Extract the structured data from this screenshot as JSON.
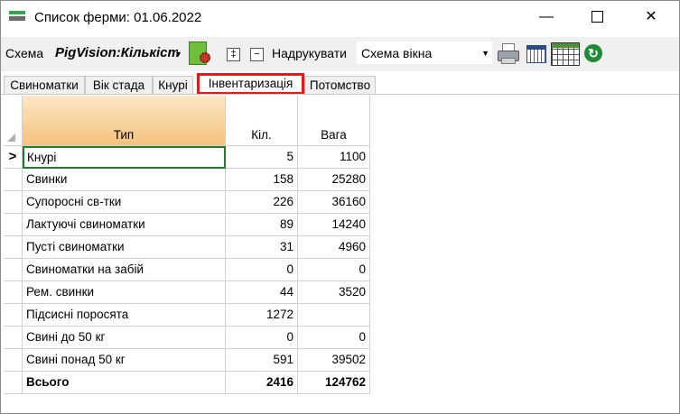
{
  "window": {
    "title": "Список ферми: 01.06.2022"
  },
  "toolbar": {
    "scheme_label": "Схема",
    "scheme_value": "PigVision:Кількіст",
    "expand_symbol": "‡",
    "collapse_symbol": "−",
    "print_label": "Надрукувати",
    "print_scheme": "Схема вікна"
  },
  "tabs": [
    {
      "label": "Свиноматки",
      "active": false
    },
    {
      "label": "Вік стада",
      "active": false
    },
    {
      "label": "Кнурі",
      "active": false
    },
    {
      "label": "Інвентаризація",
      "active": true
    },
    {
      "label": "Потомство",
      "active": false
    }
  ],
  "table": {
    "columns": [
      "Тип",
      "Кіл.",
      "Вага"
    ],
    "current_row_marker": ">",
    "rows": [
      {
        "type": "Кнурі",
        "qty": "5",
        "weight": "1100"
      },
      {
        "type": "Свинки",
        "qty": "158",
        "weight": "25280"
      },
      {
        "type": "Супоросні св-тки",
        "qty": "226",
        "weight": "36160"
      },
      {
        "type": "Лактуючі свиноматки",
        "qty": "89",
        "weight": "14240"
      },
      {
        "type": "Пусті свиноматки",
        "qty": "31",
        "weight": "4960"
      },
      {
        "type": "Свиноматки на забій",
        "qty": "0",
        "weight": "0"
      },
      {
        "type": "Рем. свинки",
        "qty": "44",
        "weight": "3520"
      },
      {
        "type": "Підсисні поросята",
        "qty": "1272",
        "weight": ""
      },
      {
        "type": "Свині до 50 кг",
        "qty": "0",
        "weight": "0"
      },
      {
        "type": "Свині понад 50 кг",
        "qty": "591",
        "weight": "39502"
      }
    ],
    "total": {
      "type": "Всього",
      "qty": "2416",
      "weight": "124762"
    }
  },
  "colors": {
    "active_tab_border": "#e01b1b",
    "selected_cell_border": "#1e7d2a",
    "header_gradient_top": "#fce7c8",
    "header_gradient_bottom": "#f5c27c"
  }
}
